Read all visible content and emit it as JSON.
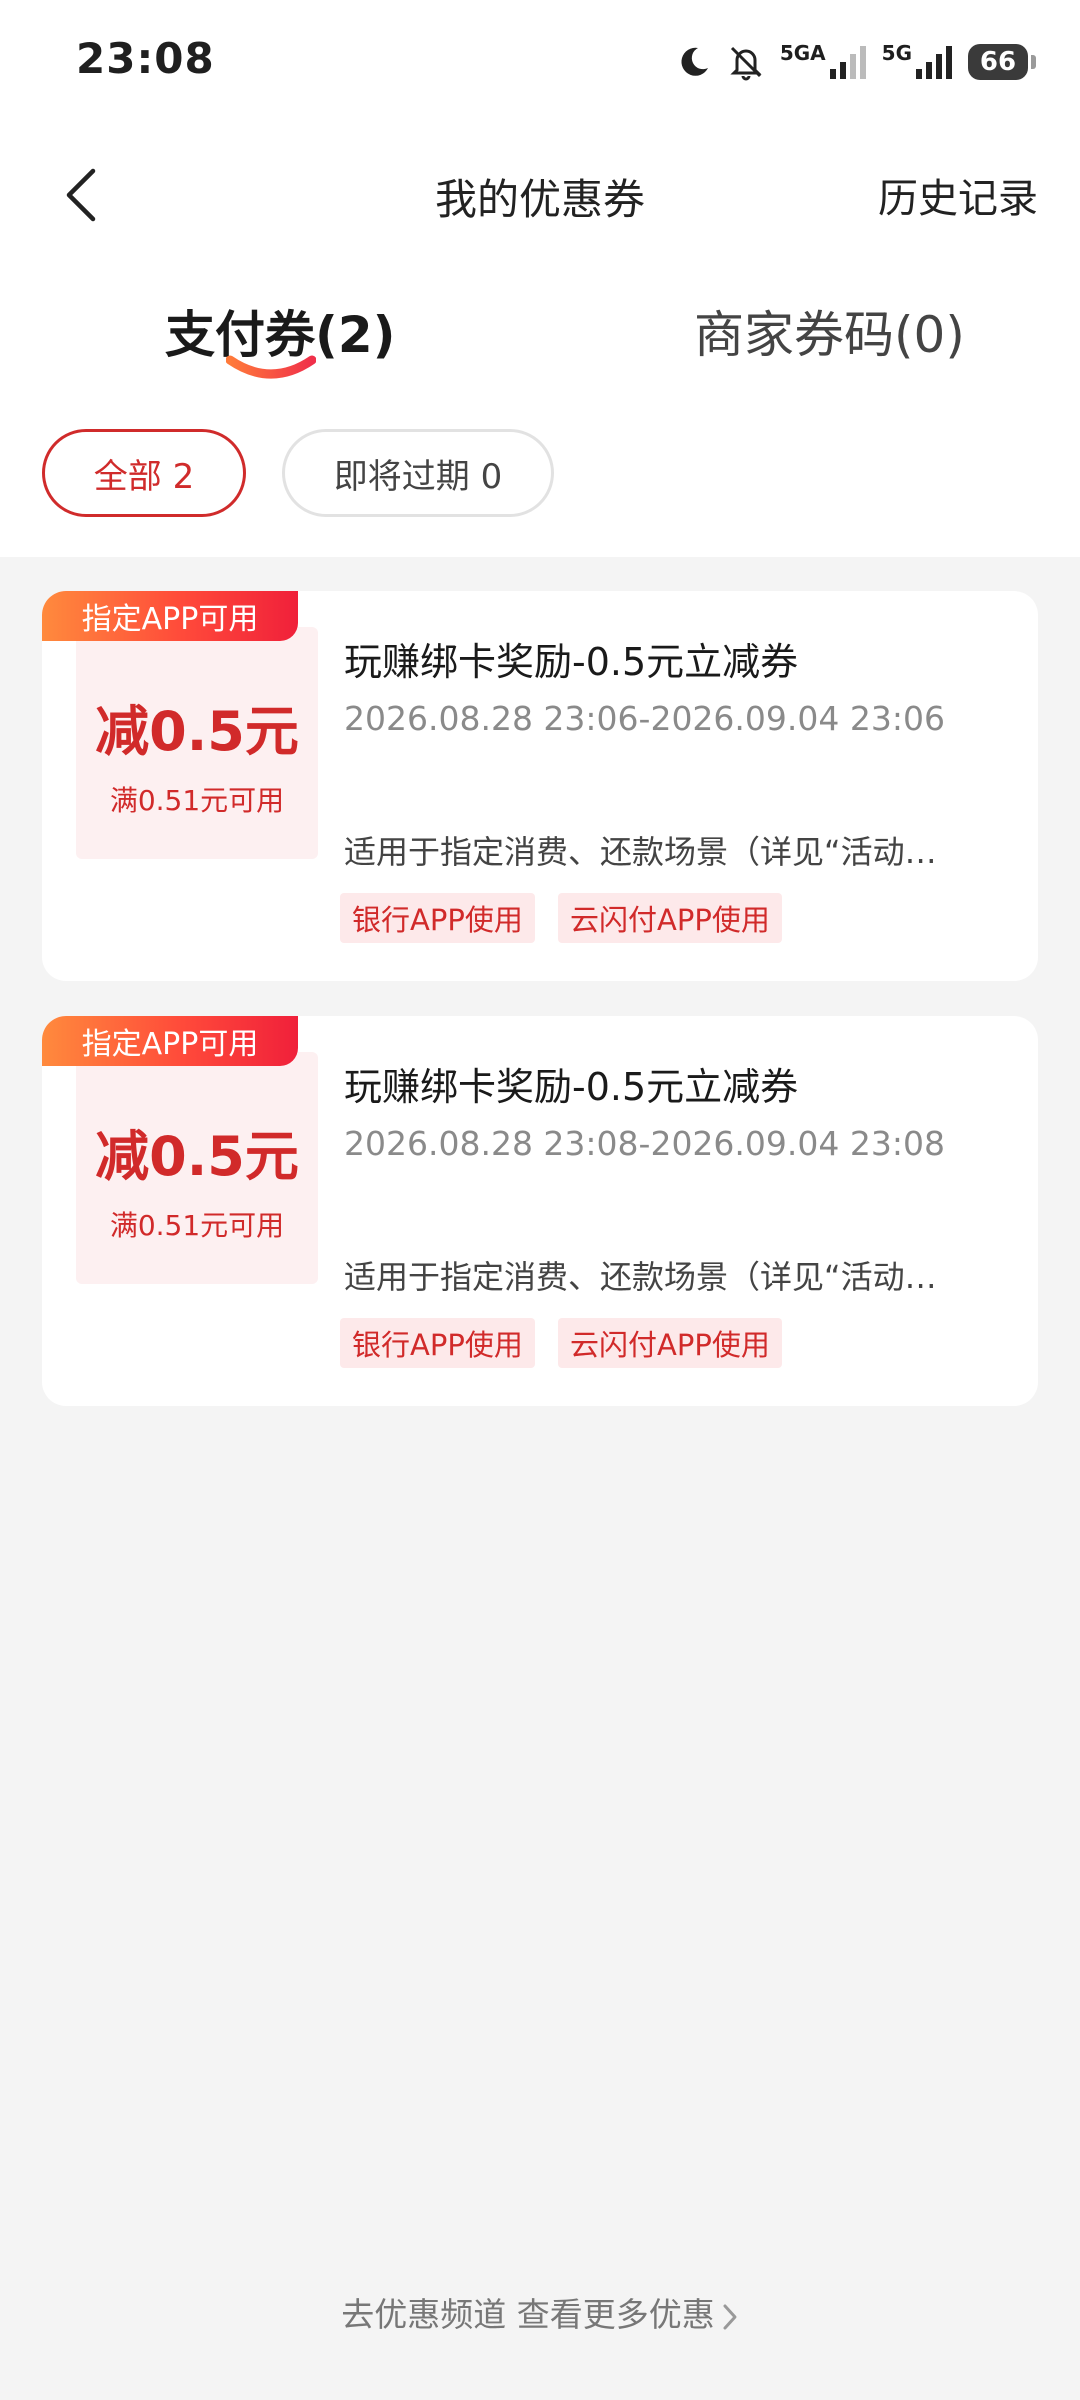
{
  "status_bar": {
    "time": "23:08",
    "network1": "5GA",
    "network2": "5G",
    "battery": "66"
  },
  "header": {
    "title": "我的优惠券",
    "history": "历史记录"
  },
  "tabs": [
    {
      "label": "支付券(2)",
      "active": true
    },
    {
      "label": "商家券码(0)",
      "active": false
    }
  ],
  "filters": [
    {
      "label": "全部 2",
      "active": true
    },
    {
      "label": "即将过期 0",
      "active": false
    }
  ],
  "coupons": [
    {
      "badge": "指定APP可用",
      "amount": "减0.5元",
      "condition": "满0.51元可用",
      "title": "玩赚绑卡奖励-0.5元立减券",
      "validity": "2026.08.28 23:06-2026.09.04 23:06",
      "description": "适用于指定消费、还款场景（详见“活动…",
      "tags": [
        "银行APP使用",
        "云闪付APP使用"
      ]
    },
    {
      "badge": "指定APP可用",
      "amount": "减0.5元",
      "condition": "满0.51元可用",
      "title": "玩赚绑卡奖励-0.5元立减券",
      "validity": "2026.08.28 23:08-2026.09.04 23:08",
      "description": "适用于指定消费、还款场景（详见“活动…",
      "tags": [
        "银行APP使用",
        "云闪付APP使用"
      ]
    }
  ],
  "footer_link": "去优惠频道 查看更多优惠",
  "colors": {
    "accent": "#d12a2a",
    "page_bg": "#f4f4f4",
    "tag_bg": "#fde9ea"
  },
  "icons": [
    "moon-icon",
    "mute-icon",
    "signal-icon",
    "battery-icon",
    "back-arrow-icon",
    "chevron-right-icon"
  ]
}
